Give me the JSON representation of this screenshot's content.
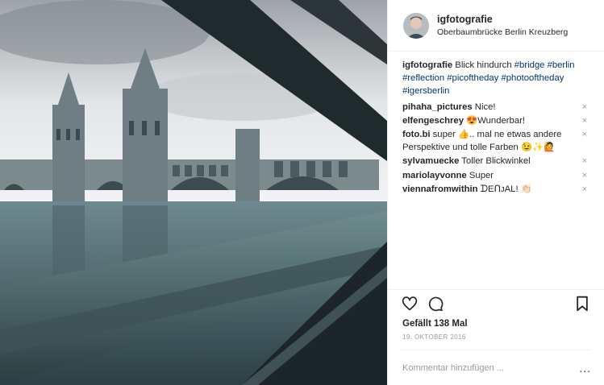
{
  "header": {
    "username": "igfotografie",
    "location": "Oberbaumbrücke Berlin Kreuzberg"
  },
  "caption": {
    "username": "igfotografie",
    "text": "Blick hindurch",
    "hashtags": [
      "#bridge",
      "#berlin",
      "#reflection",
      "#picoftheday",
      "#photooftheday",
      "#igersberlin"
    ]
  },
  "comments": [
    {
      "username": "pihaha_pictures",
      "text": "Nice!"
    },
    {
      "username": "elfengeschrey",
      "text": "😍Wunderbar!"
    },
    {
      "username": "foto.bi",
      "text": "super 👍.. mal ne etwas andere Perspektive und tolle Farben 😉✨🙋"
    },
    {
      "username": "sylvamuecke",
      "text": "Toller Blickwinkel"
    },
    {
      "username": "mariolayvonne",
      "text": "Super"
    },
    {
      "username": "viennafromwithin",
      "text": "ᗪEᑎᴊAL! 👏🏻"
    }
  ],
  "remove_icon": "×",
  "icons": {
    "like": "heart-icon",
    "comment": "comment-icon",
    "save": "bookmark-icon",
    "more": "more-options-icon"
  },
  "likes": "Gefällt 138 Mal",
  "date": "19. OKTOBER 2016",
  "add_comment": {
    "placeholder": "Kommentar hinzufügen ...",
    "more_label": "..."
  }
}
